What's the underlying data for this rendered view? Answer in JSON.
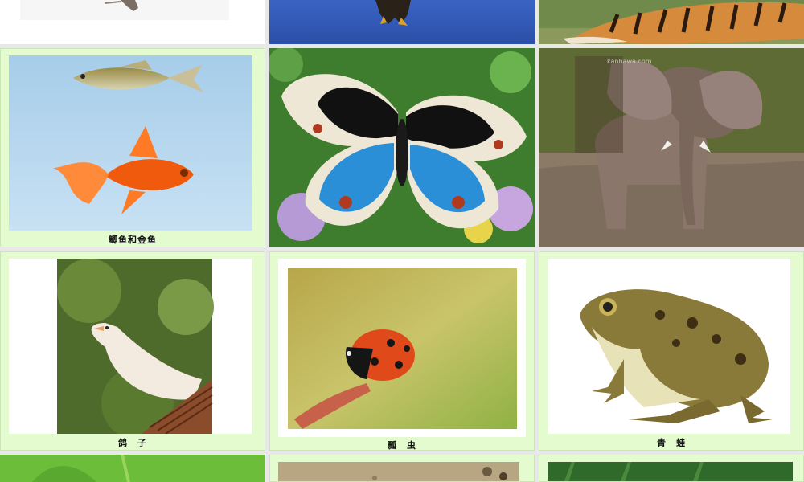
{
  "tiles": {
    "fish": {
      "caption": "鲫鱼和金鱼",
      "subject": "crucian-carp-and-goldfish"
    },
    "butterfly": {
      "caption": "",
      "subject": "blue-pansy-butterfly"
    },
    "elephant": {
      "caption": "",
      "subject": "elephant",
      "watermark": "kanhawa.com"
    },
    "pigeon": {
      "caption": "鸽　子",
      "subject": "white-pigeon"
    },
    "ladybug": {
      "caption": "瓢　虫",
      "subject": "ladybug"
    },
    "frog": {
      "caption": "青　蛙",
      "subject": "frog"
    }
  },
  "colors": {
    "frame": "#e3fbcf",
    "page_bg": "#e8e8e8"
  }
}
